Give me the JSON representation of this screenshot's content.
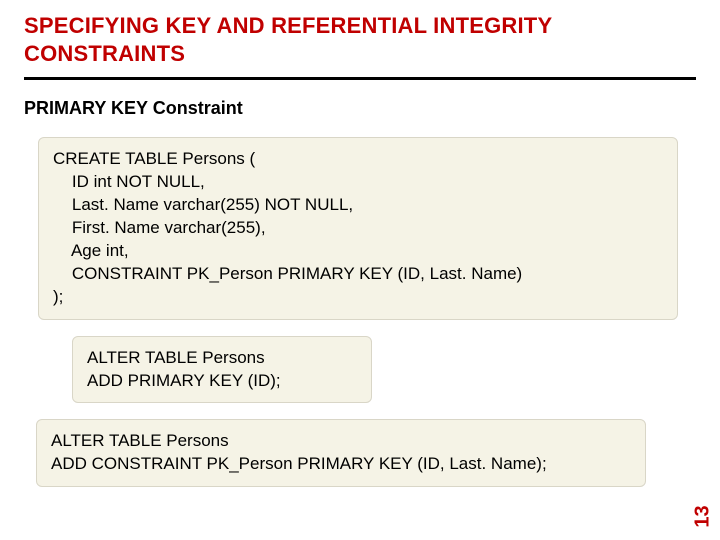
{
  "title": "SPECIFYING KEY AND REFERENTIAL INTEGRITY CONSTRAINTS",
  "subtitle": "PRIMARY KEY Constraint",
  "code1": "CREATE TABLE Persons (\n    ID int NOT NULL,\n    Last. Name varchar(255) NOT NULL,\n    First. Name varchar(255),\n    Age int,\n    CONSTRAINT PK_Person PRIMARY KEY (ID, Last. Name)\n);",
  "code2": "ALTER TABLE Persons\nADD PRIMARY KEY (ID);",
  "code3": "ALTER TABLE Persons\nADD CONSTRAINT PK_Person PRIMARY KEY (ID, Last. Name);",
  "page_number": "13"
}
